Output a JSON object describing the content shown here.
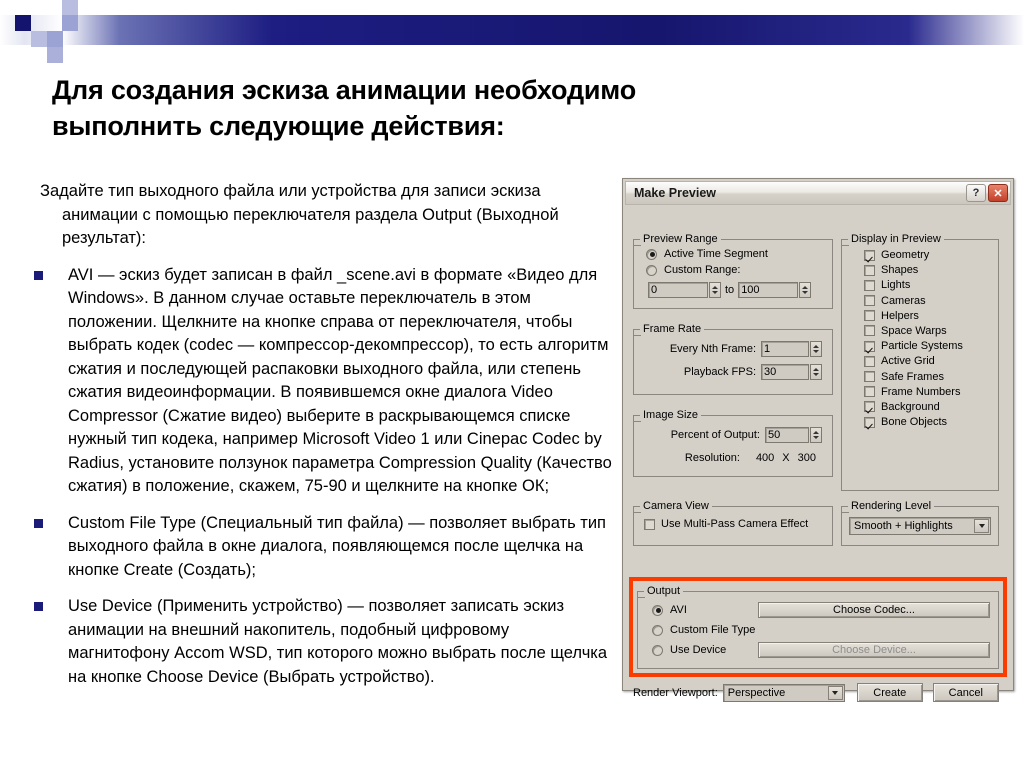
{
  "slide": {
    "title": "Для создания эскиза анимации необходимо выполнить следующие действия:",
    "intro": "Задайте тип выходного файла или устройства для записи эскиза анимации с помощью переключателя раздела Output (Выходной результат):",
    "bullets": [
      "AVI — эскиз будет записан в файл _scene.avi в формате «Видео для Windows». В данном случае оставьте переключатель в этом положении. Щелкните на кнопке справа от переключателя, чтобы выбрать кодек (codec — компрессор-декомпрессор), то есть алгоритм сжатия и последующей распаковки выходного файла, или степень сжатия видеоинформации. В появившемся окне диалога Video Compressor (Сжатие видео) выберите в раскрывающемся списке нужный тип кодека, например Microsoft Video 1 или Cinepac Codec by Radius, установите ползунок параметра Compression Quality (Качество сжатия) в положение, скажем, 75-90 и щелкните на кнопке ОК;",
      "Custom File Type (Специальный тип файла) — позволяет выбрать тип выходного файла в окне диалога, появляющемся после щелчка на кнопке Create (Создать);",
      "Use Device (Применить устройство) — позволяет записать эскиз анимации на внешний накопитель, подобный цифровому магнитофону Accom WSD, тип которого можно выбрать после щелчка на кнопке Choose Device (Выбрать устройство)."
    ]
  },
  "dialog": {
    "title": "Make Preview",
    "help_button": "?",
    "close_button": "✕",
    "preview_range": {
      "legend": "Preview Range",
      "option_active": "Active Time Segment",
      "option_custom": "Custom Range:",
      "from_value": "0",
      "to_label": "to",
      "to_value": "100"
    },
    "frame_rate": {
      "legend": "Frame Rate",
      "nth_frame_label": "Every Nth Frame:",
      "nth_frame_value": "1",
      "playback_fps_label": "Playback FPS:",
      "playback_fps_value": "30"
    },
    "image_size": {
      "legend": "Image Size",
      "percent_label": "Percent of Output:",
      "percent_value": "50",
      "resolution_label": "Resolution:",
      "resolution_width": "400",
      "resolution_sep": "X",
      "resolution_height": "300"
    },
    "camera_view": {
      "legend": "Camera View",
      "multipass_label": "Use Multi-Pass Camera Effect"
    },
    "display_in_preview": {
      "legend": "Display in Preview",
      "items": [
        {
          "label": "Geometry",
          "checked": true
        },
        {
          "label": "Shapes",
          "checked": false
        },
        {
          "label": "Lights",
          "checked": false
        },
        {
          "label": "Cameras",
          "checked": false
        },
        {
          "label": "Helpers",
          "checked": false
        },
        {
          "label": "Space Warps",
          "checked": false
        },
        {
          "label": "Particle Systems",
          "checked": true
        },
        {
          "label": "Active Grid",
          "checked": false
        },
        {
          "label": "Safe Frames",
          "checked": false
        },
        {
          "label": "Frame Numbers",
          "checked": false
        },
        {
          "label": "Background",
          "checked": true
        },
        {
          "label": "Bone Objects",
          "checked": true
        }
      ]
    },
    "rendering_level": {
      "legend": "Rendering Level",
      "value": "Smooth + Highlights"
    },
    "output": {
      "legend": "Output",
      "avi_label": "AVI",
      "choose_codec_label": "Choose Codec...",
      "custom_file_type_label": "Custom File Type",
      "use_device_label": "Use Device",
      "choose_device_label": "Choose Device..."
    },
    "footer": {
      "render_viewport_label": "Render Viewport:",
      "render_viewport_value": "Perspective",
      "create_label": "Create",
      "cancel_label": "Cancel"
    },
    "highlight_color": "#fa3c00"
  }
}
